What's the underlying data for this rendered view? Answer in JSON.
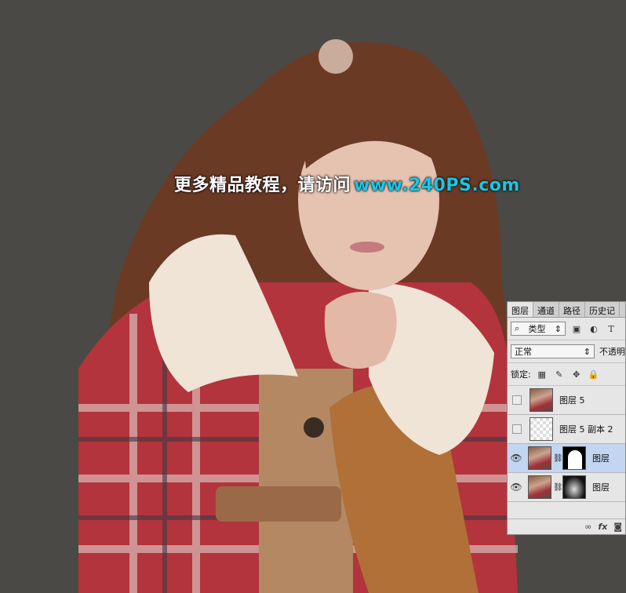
{
  "watermark": {
    "text": "更多精品教程，请访问",
    "url": "www.240PS.com"
  },
  "layers_panel": {
    "tabs": [
      "图层",
      "通道",
      "路径",
      "历史记"
    ],
    "filter": {
      "label": "类型",
      "icon_labels": [
        "T"
      ]
    },
    "blend_mode": "正常",
    "opacity_label": "不透明",
    "lock_label": "锁定:",
    "layers": [
      {
        "name": "图层 5",
        "visible": false,
        "thumb": "smart-object-photo",
        "mask": false
      },
      {
        "name": "图层 5 副本 2",
        "visible": false,
        "thumb": "transparent",
        "mask": false
      },
      {
        "name": "图层",
        "visible": true,
        "thumb": "photo",
        "mask": true,
        "selected": true
      },
      {
        "name": "图层",
        "visible": true,
        "thumb": "photo",
        "mask": true
      }
    ],
    "footer_icons": [
      "link-icon",
      "fx-icon",
      "mask-icon"
    ],
    "footer_fx": "fx"
  }
}
